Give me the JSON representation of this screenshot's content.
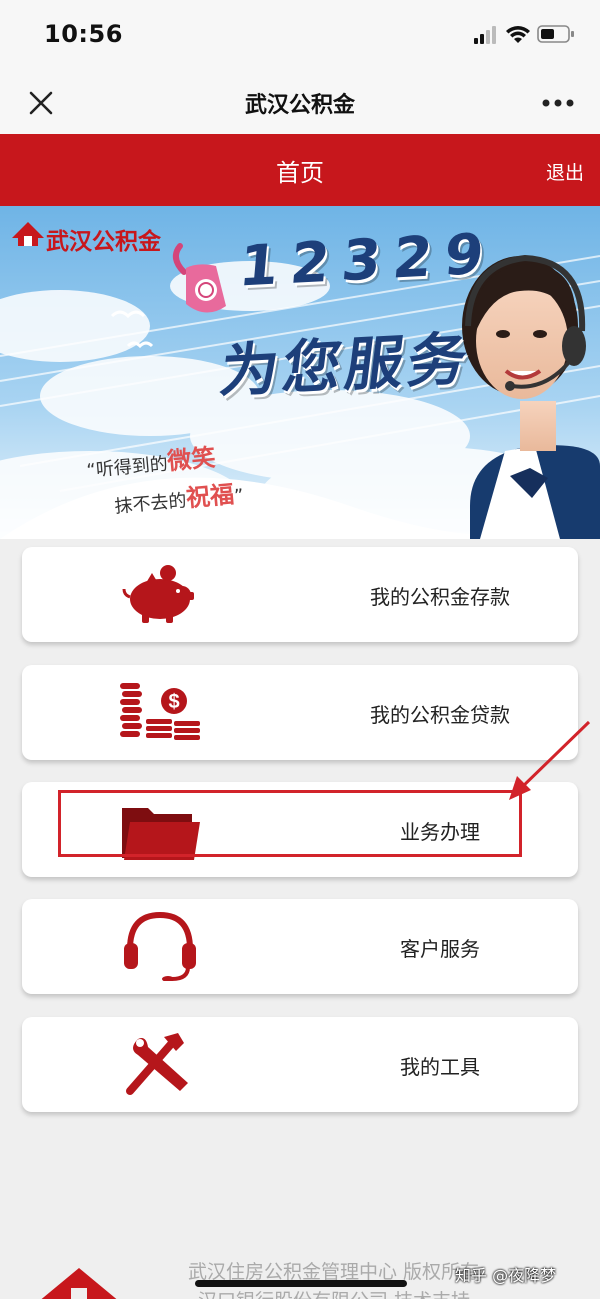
{
  "status_bar": {
    "time": "10:56"
  },
  "nav": {
    "title": "武汉公积金"
  },
  "header": {
    "title": "首页",
    "logout": "退出"
  },
  "banner": {
    "brand": "武汉公积金",
    "hotline": "12329",
    "slogan": "为您服务",
    "tagline_1_prefix": "“听得到的",
    "tagline_1_accent": "微笑",
    "tagline_2_prefix": "抹不去的",
    "tagline_2_accent": "祝福",
    "tagline_2_suffix": "”"
  },
  "menu": [
    {
      "label": "我的公积金存款",
      "icon": "piggy-bank-icon"
    },
    {
      "label": "我的公积金贷款",
      "icon": "coins-money-icon"
    },
    {
      "label": "业务办理",
      "icon": "folder-icon"
    },
    {
      "label": "客户服务",
      "icon": "headset-icon"
    },
    {
      "label": "我的工具",
      "icon": "tools-icon"
    }
  ],
  "footer": {
    "line1": "武汉住房公积金管理中心    版权所有",
    "line2": "汉口银行股份有限公司    技术支持"
  },
  "watermark": "知乎 @夜降梦",
  "colors": {
    "brand_red": "#c7171c",
    "annotation_red": "#d2232a",
    "banner_blue": "#1d3f7a"
  }
}
